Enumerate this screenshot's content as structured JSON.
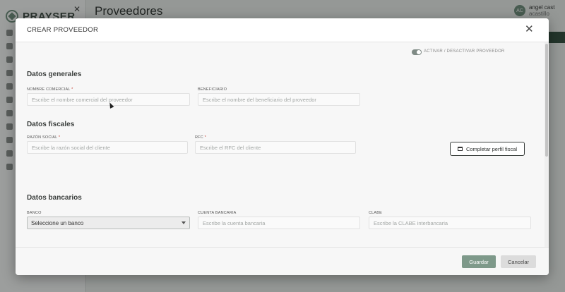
{
  "app": {
    "logo_text": "PRAYSER",
    "page_title": "Proveedores",
    "user": {
      "initials": "AC",
      "name": "angel cast",
      "handle": "acastillo"
    }
  },
  "modal": {
    "title": "CREAR PROVEEDOR",
    "toggle_label": "ACTIVAR / DESACTIVAR PROVEEDOR",
    "toggle_on": true,
    "sections": {
      "general": "Datos generales",
      "fiscal": "Datos fiscales",
      "bank": "Datos bancarios"
    },
    "fields": {
      "commercial_name": {
        "label": "NOMBRE COMERCIAL",
        "required": "*",
        "placeholder": "Escribe el nombre comercial del proveedor"
      },
      "beneficiary": {
        "label": "BENEFICIARIO",
        "placeholder": "Escribe el nombre del beneficiario del proveedor"
      },
      "social_reason": {
        "label": "RAZÓN SOCIAL",
        "required": "*",
        "placeholder": "Escribe la razón social del cliente"
      },
      "rfc": {
        "label": "RFC",
        "required": "*",
        "placeholder": "Escribe el RFC del cliente"
      },
      "bank": {
        "label": "BANCO",
        "value": "Seleccione un banco"
      },
      "account": {
        "label": "CUENTA BANCARIA",
        "placeholder": "Escribe la cuenta bancaria"
      },
      "clabe": {
        "label": "CLABE",
        "placeholder": "Escribe la CLABE interbancaria"
      }
    },
    "complete_fiscal_button": "Completar perfil fiscal",
    "save_button": "Guardar",
    "cancel_button": "Cancelar"
  },
  "colors": {
    "accent": "#7e998a",
    "dark_green": "#2f4a3b"
  }
}
